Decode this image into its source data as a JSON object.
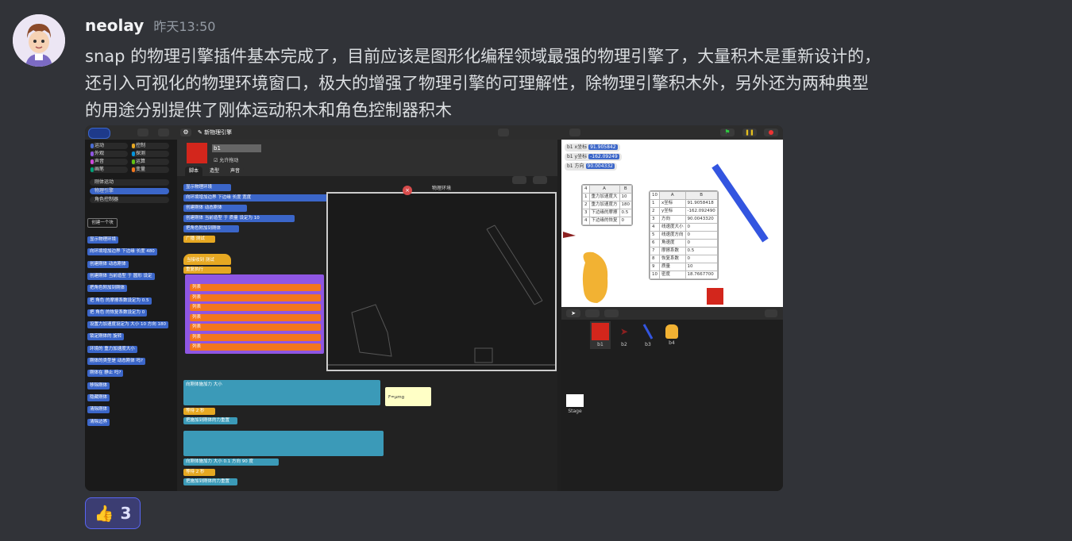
{
  "message": {
    "username": "neolay",
    "timestamp": "昨天13:50",
    "lines": [
      "snap 的物理引擎插件基本完成了，目前应该是图形化编程领域最强的物理引擎了，大量积木是重新设计的，",
      "还引入可视化的物理环境窗口，极大的增强了物理引擎的可理解性，除物理引擎积木外，另外还为两种典型",
      "的用途分别提供了刚体运动积木和角色控制器积木"
    ]
  },
  "reaction": {
    "emoji_icon": "thumbs-up-icon",
    "count": "3"
  },
  "snap": {
    "project_title": "✎ 新物理引擎",
    "categories": [
      {
        "label": "运动",
        "color": "#4a6cd4"
      },
      {
        "label": "控制",
        "color": "#e6a822"
      },
      {
        "label": "外观",
        "color": "#8f56e3"
      },
      {
        "label": "探测",
        "color": "#0494dc"
      },
      {
        "label": "声音",
        "color": "#cf4ad9"
      },
      {
        "label": "运算",
        "color": "#62c213"
      },
      {
        "label": "画笔",
        "color": "#00a178"
      },
      {
        "label": "变量",
        "color": "#f3761d"
      }
    ],
    "libraries": [
      "刚体运动",
      "物理引擎",
      "角色控制器"
    ],
    "make_block_button": "创建一个块",
    "palette_blocks": [
      "显示物理环境",
      "向环境增加边界 下边缘 长度 480",
      "创建刚体 动态刚体",
      "创建刚体 当前造型 于 圆形 设定",
      "把角色附加到刚体",
      "把 角色 的摩擦系数设定为 0.5",
      "把 角色 的恢复系数设定为 0",
      "设置力加速度设定为 大小 10 方向 180",
      "锁定刚体的 旋转",
      "环境的 重力加速度大小",
      "刚体的类型是 动态刚体 吗?",
      "刚体在 静止 吗?",
      "移除刚体",
      "隐藏刚体",
      "清除刚体",
      "清除边界"
    ],
    "sprite": {
      "name": "b1",
      "checkbox_label": "允许拖动",
      "tabs": [
        "脚本",
        "造型",
        "声音"
      ]
    },
    "physics_window_title": "物理环境",
    "watchers": [
      {
        "label": "b1 x坐标",
        "value": "91.905842"
      },
      {
        "label": "b1 y坐标",
        "value": "-162.09249"
      },
      {
        "label": "b1 方向",
        "value": "90.004332"
      }
    ],
    "table1": {
      "count": "4",
      "headers": [
        "A",
        "B"
      ],
      "rows": [
        [
          "重力加速度大",
          "10"
        ],
        [
          "重力加速度方",
          "180"
        ],
        [
          "下边缘的摩擦",
          "0.5"
        ],
        [
          "下边缘的恢复",
          "0"
        ]
      ]
    },
    "table2": {
      "count": "10",
      "headers": [
        "A",
        "B"
      ],
      "rows": [
        [
          "x坐标",
          "91.9058418"
        ],
        [
          "y坐标",
          "-162.092490"
        ],
        [
          "方向",
          "90.0043320"
        ],
        [
          "线速度大小",
          "0"
        ],
        [
          "线速度方向",
          "0"
        ],
        [
          "角速度",
          "0"
        ],
        [
          "摩擦系数",
          "0.5"
        ],
        [
          "恢复系数",
          "0"
        ],
        [
          "质量",
          "10"
        ],
        [
          "密度",
          "18.7667700"
        ]
      ]
    },
    "sprites": [
      "b1",
      "b2",
      "b3",
      "b4"
    ],
    "stage_label": "Stage",
    "comment_text": "F=μmg",
    "script_labels": {
      "hat": "当接收到 测试",
      "repeat": "重复执行",
      "apply_force": "向刚体施加力 大小",
      "direction": "方向",
      "degree": "度",
      "wait": "等待",
      "seconds": "秒",
      "clear_force": "把施加到刚体的力重置",
      "list": "列表"
    }
  }
}
